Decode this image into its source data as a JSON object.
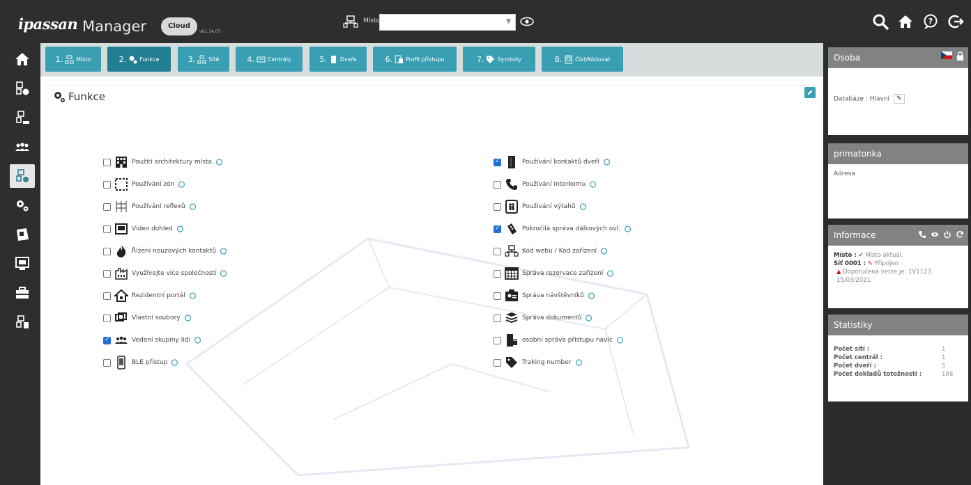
{
  "header": {
    "brand": "ipassan",
    "product": "Manager",
    "cloud_badge": "Cloud",
    "version": "v01.14.07",
    "place_label": "Místo",
    "place_value": ""
  },
  "tabs": [
    {
      "num": "1.",
      "label": "Místo",
      "icon": "site-icon"
    },
    {
      "num": "2.",
      "label": "Funkce",
      "icon": "gears-icon"
    },
    {
      "num": "3.",
      "label": "Sítě",
      "icon": "network-icon"
    },
    {
      "num": "4.",
      "label": "Centrály",
      "icon": "controller-icon"
    },
    {
      "num": "5.",
      "label": "Dveře",
      "icon": "door-icon"
    },
    {
      "num": "6.",
      "label": "Profil přístupu",
      "icon": "access-profile-icon"
    },
    {
      "num": "7.",
      "label": "Symboly",
      "icon": "tag-icon"
    },
    {
      "num": "8.",
      "label": "Číst/Kódovat",
      "icon": "reader-icon"
    }
  ],
  "panel": {
    "title": "Funkce"
  },
  "features_left": [
    {
      "label": "Použití architektury místa",
      "checked": false,
      "icon": "building-icon"
    },
    {
      "label": "Používání zón",
      "checked": false,
      "icon": "zone-icon"
    },
    {
      "label": "Používání reflexů",
      "checked": false,
      "icon": "reflex-icon"
    },
    {
      "label": "Video dohled",
      "checked": false,
      "icon": "video-icon"
    },
    {
      "label": "Řízení nouzových kontaktů",
      "checked": false,
      "icon": "fire-icon"
    },
    {
      "label": "Využívejte více společností",
      "checked": false,
      "icon": "factory-icon"
    },
    {
      "label": "Rezidentní portál",
      "checked": false,
      "icon": "home-portal-icon"
    },
    {
      "label": "Vlastní soubory",
      "checked": false,
      "icon": "files-icon"
    },
    {
      "label": "Vedení skupiny lidí",
      "checked": true,
      "icon": "group-icon"
    },
    {
      "label": "BLE přístup",
      "checked": false,
      "icon": "phone-icon"
    }
  ],
  "features_right": [
    {
      "label": "Používání kontaktů dveří",
      "checked": true,
      "icon": "door-contact-icon"
    },
    {
      "label": "Používání interkomu",
      "checked": false,
      "icon": "intercom-icon"
    },
    {
      "label": "Používání výtahů",
      "checked": false,
      "icon": "elevator-icon"
    },
    {
      "label": "Pokročilá správa dálkových ovl.",
      "checked": true,
      "icon": "remote-icon"
    },
    {
      "label": "Kód webu / Kód zařízení",
      "checked": false,
      "icon": "site-code-icon"
    },
    {
      "label": "Správa rezervace zařízení",
      "checked": false,
      "icon": "calendar-icon"
    },
    {
      "label": "Správa návštěvníků",
      "checked": false,
      "icon": "visitor-icon"
    },
    {
      "label": "Správa dokumentů",
      "checked": false,
      "icon": "documents-icon"
    },
    {
      "label": "osobní správa přístupu navíc",
      "checked": false,
      "icon": "person-access-icon"
    },
    {
      "label": "Traking number",
      "checked": false,
      "icon": "tag-small-icon"
    }
  ],
  "right_panel": {
    "osoba": {
      "title": "Osoba",
      "database": "Databáze : Hlavní"
    },
    "primatonka": {
      "title": "primatonka",
      "address": "Adresa"
    },
    "informace": {
      "title": "Informace",
      "misto_label": "Místo :",
      "misto_value": "Místo aktuál.",
      "sit_label": "Síť 0001 :",
      "sit_value": "Připojen",
      "warning": "Doporučená verze je: 1V1123 15/03/2021"
    },
    "statistiky": {
      "title": "Statistiky",
      "rows": [
        {
          "label": "Počet sítí :",
          "value": "1"
        },
        {
          "label": "Počet centrál :",
          "value": "1"
        },
        {
          "label": "Počet dveří :",
          "value": "5"
        },
        {
          "label": "Počet dokladů totožnosti :",
          "value": "188"
        }
      ]
    }
  },
  "colors": {
    "tab": "#3a9fb2",
    "tab_active": "#227f93",
    "dark": "#2e2e2e",
    "right_header": "#828282"
  }
}
